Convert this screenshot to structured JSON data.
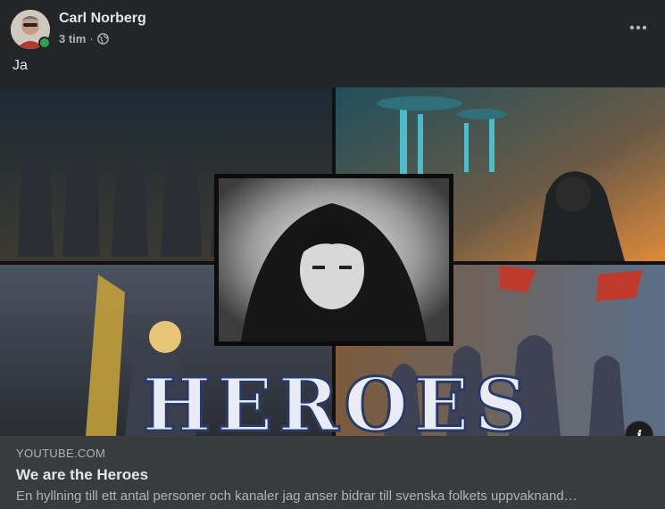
{
  "post": {
    "author": "Carl Norberg",
    "time": "3 tim",
    "separator": "·",
    "privacy_icon": "globe-icon",
    "text": "Ja",
    "more_icon": "more-horizontal-icon"
  },
  "media": {
    "title_text": "HEROES",
    "info_label": "i"
  },
  "link": {
    "domain": "YOUTUBE.COM",
    "title": "We are the Heroes",
    "description": "En hyllning till ett antal personer och kanaler jag anser bidrar till svenska folkets uppvaknand…"
  },
  "colors": {
    "background": "#242526",
    "preview_background": "#3a3b3c",
    "primary_text": "#e4e6eb",
    "secondary_text": "#b0b3b8",
    "online": "#31a24c"
  }
}
